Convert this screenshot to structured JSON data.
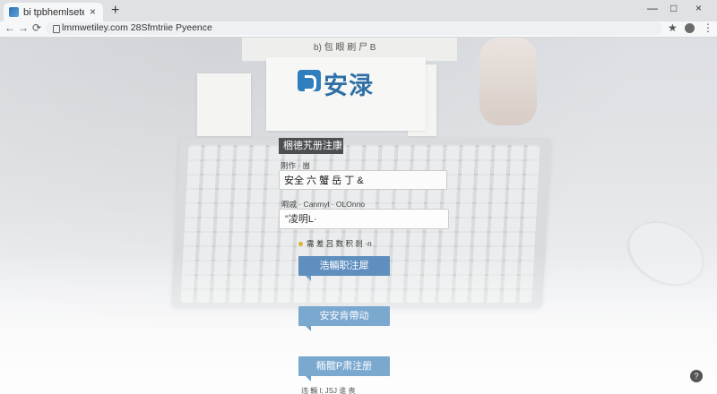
{
  "browser": {
    "tab_title": "bi tpbhemlsetecic",
    "tab_close": "×",
    "new_tab": "+",
    "window_controls": [
      "—",
      "□",
      "×"
    ],
    "nav": {
      "back": "←",
      "forward": "→",
      "reload": "⟳"
    },
    "url": "lmmwetiley.com 28Sfmtriie Pyeence",
    "star": "★",
    "menu": "⋮"
  },
  "page": {
    "doc_top_text": "b) 包 眼 刷 尸 B",
    "logo": {
      "text": "安渌"
    },
    "form": {
      "title": "梱徳艽册注康",
      "username_label": "刚作 · 崮",
      "username_value": "安全 六 蟹 岳 丁 &",
      "password_label": "暇戚 · Canmyl · OLOnno",
      "password_value": "\"凌明L·",
      "remember_text": "需 差 吕 数 积 刹 ·n"
    },
    "buttons": {
      "login": "浩輛职注犀",
      "secure": "安安肯帶动",
      "register": "粫髋P肃注册"
    },
    "footer": "违 輛 l; JSJ 谁 喪",
    "help_icon": "?"
  }
}
